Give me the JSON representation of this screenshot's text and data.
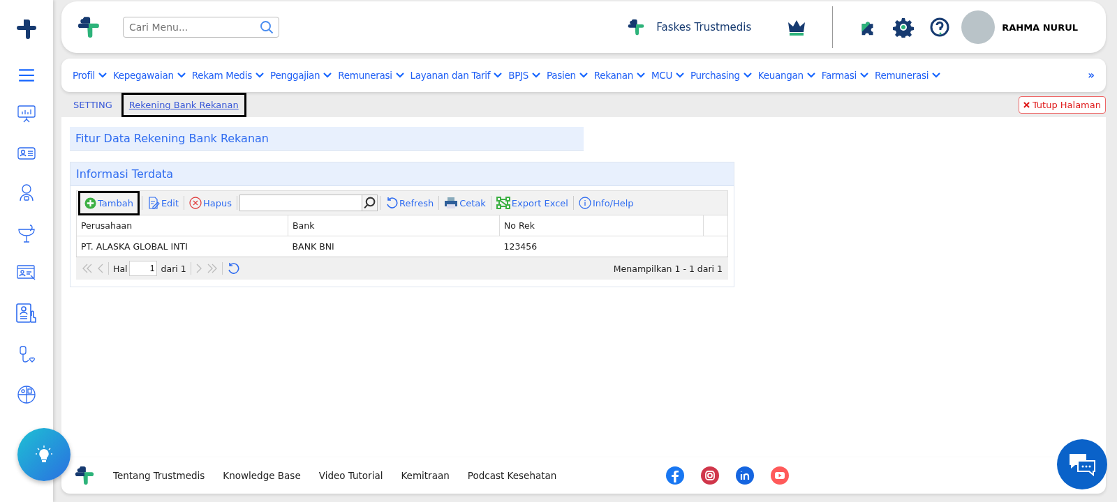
{
  "header": {
    "search": {
      "placeholder": "Cari Menu..."
    },
    "facility": "Faskes Trustmedis",
    "user": "RAHMA NURUL"
  },
  "menu": {
    "items": [
      "Profil",
      "Kepegawaian",
      "Rekam Medis",
      "Penggajian",
      "Remunerasi",
      "Layanan dan Tarif",
      "BPJS",
      "Pasien",
      "Rekanan",
      "MCU",
      "Purchasing",
      "Keuangan",
      "Farmasi",
      "Remunerasi"
    ],
    "more": "»"
  },
  "breadcrumb": {
    "items": [
      {
        "label": "SETTING",
        "selected": false,
        "highlighted": false
      },
      {
        "label": "Rekening Bank Rekanan",
        "selected": true,
        "highlighted": true
      }
    ],
    "close": "Tutup Halaman"
  },
  "feature_panel": {
    "title": "Fitur Data Rekening Bank Rekanan"
  },
  "data_panel": {
    "title": "Informasi Terdata",
    "toolbar": [
      {
        "kind": "add",
        "label": "Tambah",
        "highlighted": true
      },
      {
        "kind": "edit",
        "label": "Edit",
        "highlighted": false
      },
      {
        "kind": "delete",
        "label": "Hapus",
        "highlighted": false
      },
      {
        "kind": "search"
      },
      {
        "kind": "refresh",
        "label": "Refresh",
        "highlighted": false
      },
      {
        "kind": "print",
        "label": "Cetak",
        "highlighted": false
      },
      {
        "kind": "excel",
        "label": "Export Excel",
        "highlighted": false
      },
      {
        "kind": "info",
        "label": "Info/Help",
        "highlighted": false
      }
    ],
    "table": {
      "columns": [
        "Perusahaan",
        "Bank",
        "No Rek"
      ],
      "rows": [
        [
          "PT. ALASKA GLOBAL INTI",
          "BANK BNI",
          "123456"
        ]
      ]
    },
    "pager": {
      "page_label": "Hal",
      "page": "1",
      "of": "dari 1",
      "summary": "Menampilkan 1 - 1 dari 1"
    }
  },
  "footer": {
    "links": [
      "Tentang Trustmedis",
      "Knowledge Base",
      "Video Tutorial",
      "Kemitraan",
      "Podcast Kesehatan"
    ]
  }
}
